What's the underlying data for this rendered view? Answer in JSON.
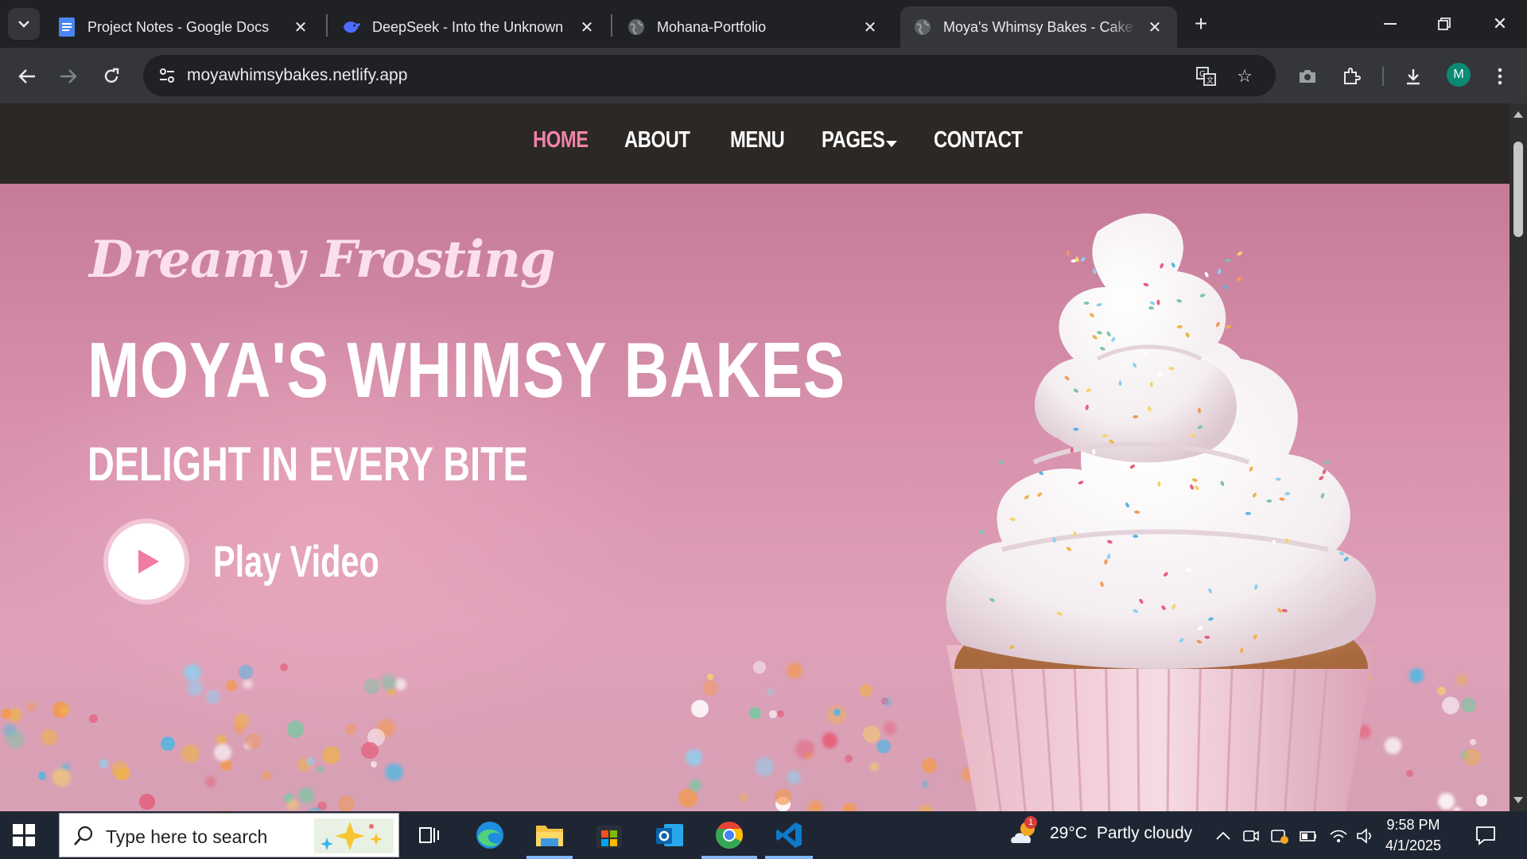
{
  "browser": {
    "tabs": [
      {
        "title": "Project Notes - Google Docs",
        "icon": "google-docs-icon"
      },
      {
        "title": "DeepSeek - Into the Unknown",
        "icon": "deepseek-icon"
      },
      {
        "title": "Mohana-Portfolio",
        "icon": "globe-icon"
      },
      {
        "title": "Moya's Whimsy Bakes - Cake Shop",
        "icon": "globe-icon",
        "active": true
      }
    ],
    "url": "moyawhimsybakes.netlify.app",
    "profile_initial": "M"
  },
  "site": {
    "nav": {
      "home": "HOME",
      "about": "ABOUT",
      "menu": "MENU",
      "pages": "PAGES",
      "contact": "CONTACT",
      "active": "HOME"
    },
    "hero": {
      "script_title": "Dreamy Frosting",
      "title": "MOYA'S WHIMSY BAKES",
      "tagline": "DELIGHT IN EVERY BITE",
      "play_label": "Play Video"
    },
    "colors": {
      "accent": "#f183a9",
      "nav_bg": "#2b2826",
      "hero_bg": "#d892ae"
    }
  },
  "taskbar": {
    "search_placeholder": "Type here to search",
    "weather": {
      "temp": "29°C",
      "condition": "Partly cloudy",
      "badge": "1"
    },
    "time": "9:58 PM",
    "date": "4/1/2025"
  }
}
